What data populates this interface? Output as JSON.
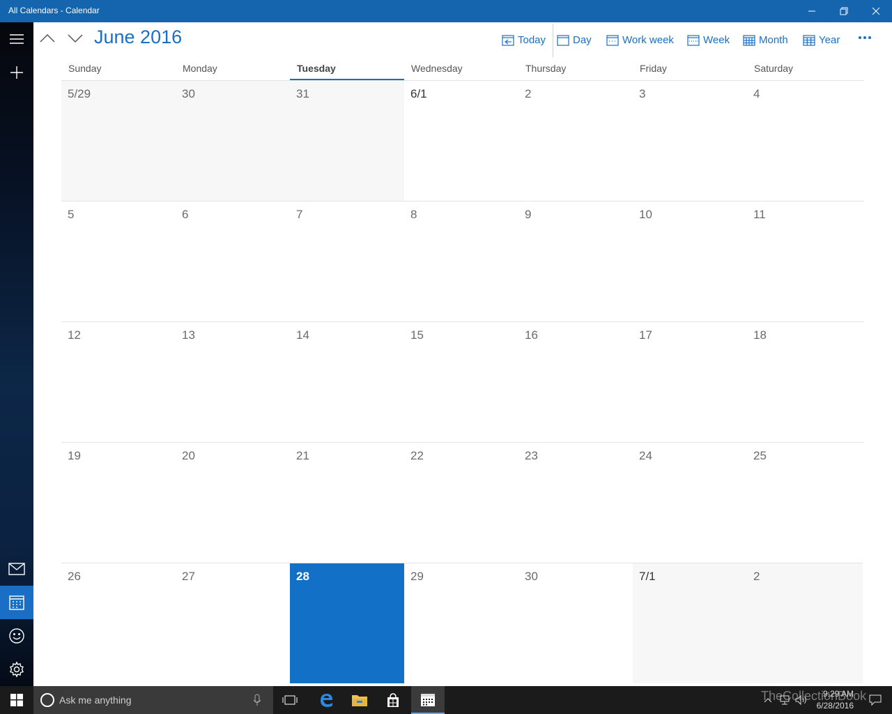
{
  "window": {
    "title": "All Calendars - Calendar"
  },
  "header": {
    "month_title": "June 2016",
    "commands": [
      {
        "label": "Today",
        "icon": "today-icon"
      },
      {
        "label": "Day",
        "icon": "day-view-icon"
      },
      {
        "label": "Work week",
        "icon": "work-week-icon"
      },
      {
        "label": "Week",
        "icon": "week-icon"
      },
      {
        "label": "Month",
        "icon": "month-icon"
      },
      {
        "label": "Year",
        "icon": "year-icon"
      }
    ]
  },
  "weekdays": [
    "Sunday",
    "Monday",
    "Tuesday",
    "Wednesday",
    "Thursday",
    "Friday",
    "Saturday"
  ],
  "today_weekday_index": 2,
  "weeks": [
    [
      "5/29",
      "30",
      "31",
      "6/1",
      "2",
      "3",
      "4"
    ],
    [
      "5",
      "6",
      "7",
      "8",
      "9",
      "10",
      "11"
    ],
    [
      "12",
      "13",
      "14",
      "15",
      "16",
      "17",
      "18"
    ],
    [
      "19",
      "20",
      "21",
      "22",
      "23",
      "24",
      "25"
    ],
    [
      "26",
      "27",
      "28",
      "29",
      "30",
      "7/1",
      "2"
    ]
  ],
  "taskbar": {
    "search_placeholder": "Ask me anything",
    "time": "9:29 AM",
    "date": "6/28/2016",
    "watermark": "TheCollectionBook"
  },
  "colors": {
    "accent": "#1a6fc4",
    "titlebar": "#1464ae",
    "today_cell": "#1270c6"
  }
}
